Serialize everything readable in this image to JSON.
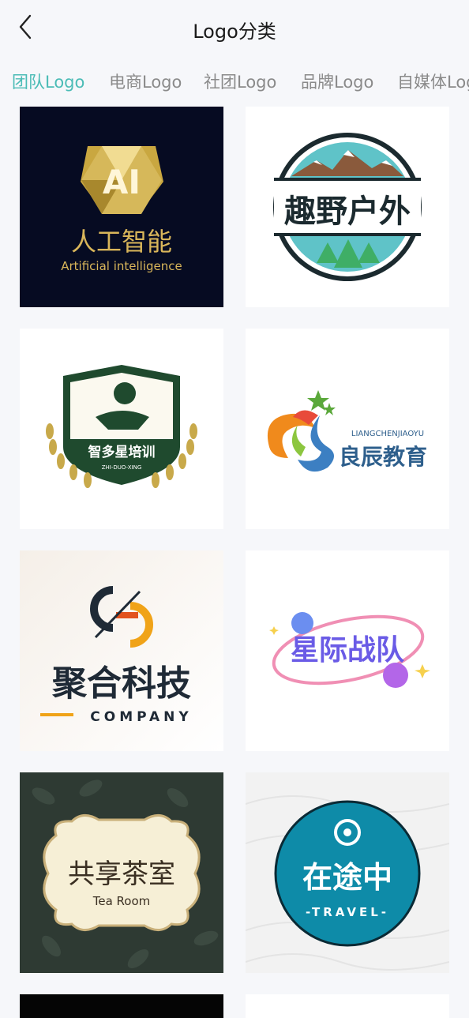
{
  "header": {
    "title": "Logo分类"
  },
  "tabs": [
    {
      "label": "团队Logo",
      "active": true
    },
    {
      "label": "电商Logo"
    },
    {
      "label": "社团Logo"
    },
    {
      "label": "品牌Logo"
    },
    {
      "label": "自媒体Logo"
    }
  ],
  "logos": [
    {
      "initials": "AI",
      "name": "人工智能",
      "subtitle": "Artificial intelligence"
    },
    {
      "name": "趣野户外"
    },
    {
      "name": "智多星培训",
      "subtitle": "ZHI-DUO-XING"
    },
    {
      "name": "良辰教育",
      "subtitle": "LIANGCHENJIAOYU"
    },
    {
      "name": "聚合科技",
      "subtitle": "COMPANY"
    },
    {
      "name": "星际战队"
    },
    {
      "name": "共享茶室",
      "subtitle": "Tea Room"
    },
    {
      "name": "在途中",
      "subtitle": "-TRAVEL-"
    }
  ],
  "colors": {
    "accent": "#4bbcb6",
    "inactive_tab": "#8a8a8a"
  }
}
